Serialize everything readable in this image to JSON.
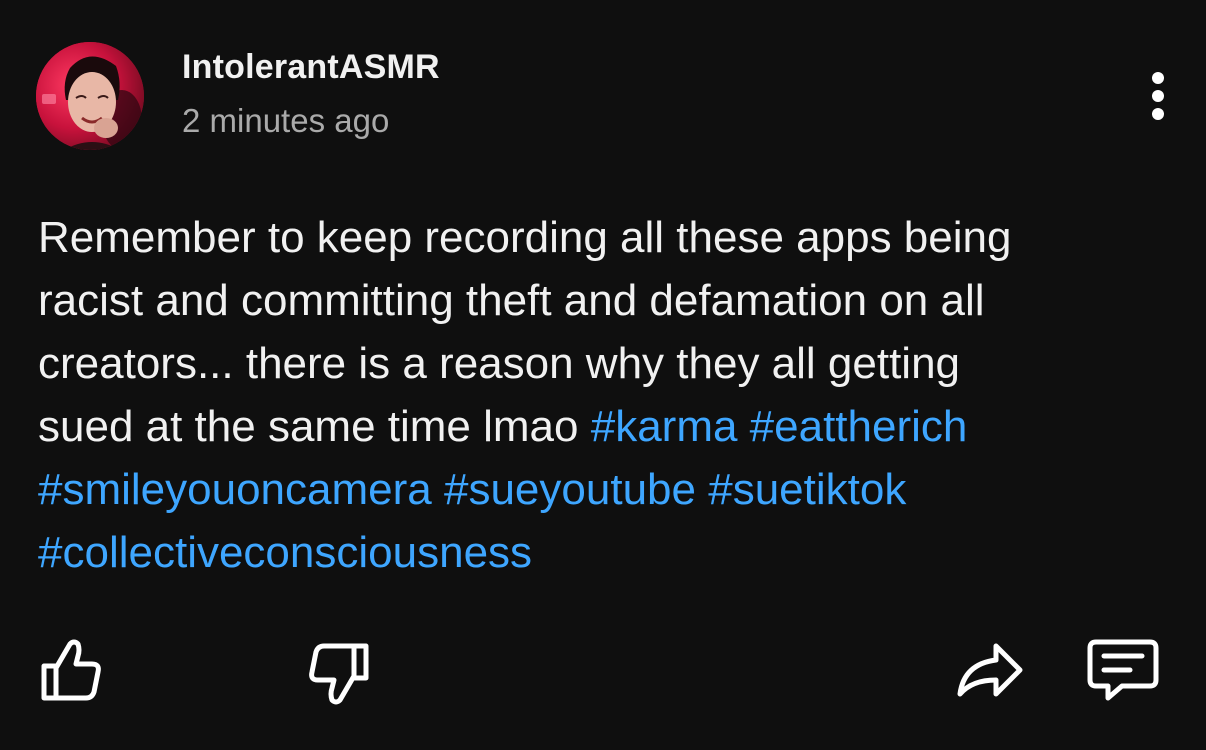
{
  "post": {
    "author": "IntolerantASMR",
    "time": "2 minutes ago",
    "text_lines": [
      "Remember to keep recording all these apps being",
      "racist and committing theft and defamation on all",
      "creators... there is a reason why they all getting",
      "sued at the same time lmao "
    ],
    "hashtags": [
      "#karma",
      "#eattherich",
      "#smileyouoncamera",
      "#sueyoutube",
      "#suetiktok",
      "#collectiveconsciousness"
    ]
  },
  "icons": {
    "menu": "more-vertical-icon",
    "like": "thumbs-up-icon",
    "dislike": "thumbs-down-icon",
    "share": "share-icon",
    "reply": "comment-icon"
  },
  "colors": {
    "background": "#0f0f0f",
    "text": "#f1f1f1",
    "secondary_text": "#aaaaaa",
    "hashtag": "#3ea6ff"
  }
}
